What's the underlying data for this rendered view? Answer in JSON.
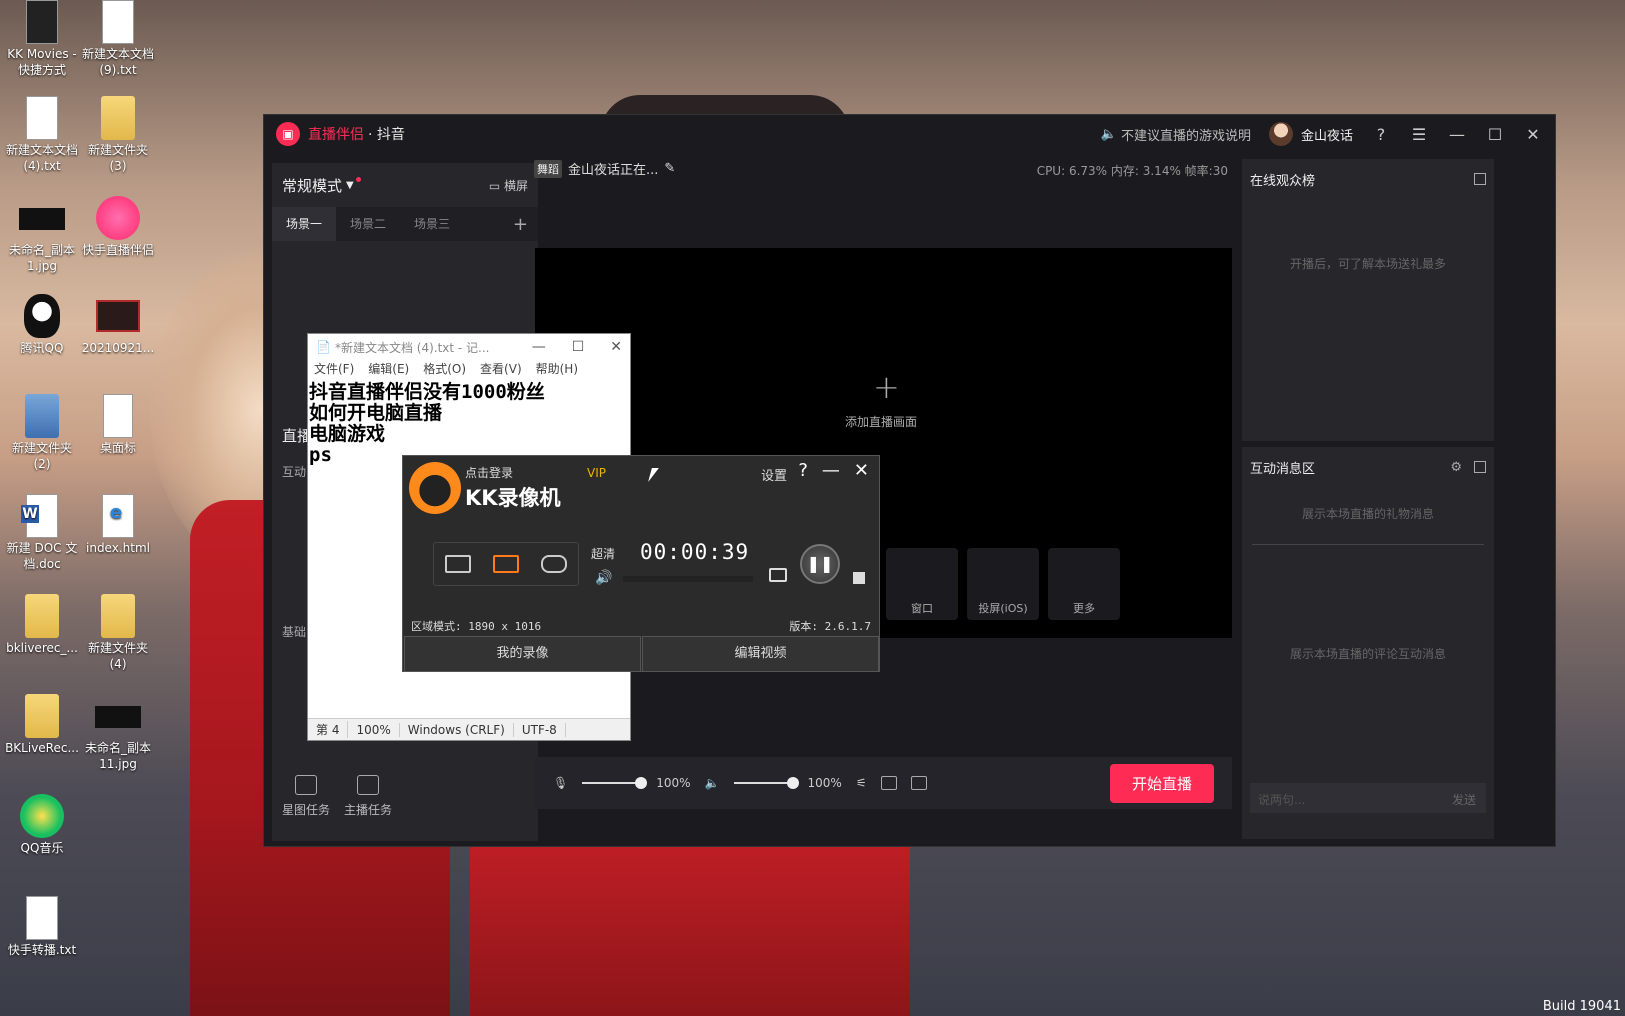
{
  "desktop": {
    "icons": [
      {
        "label": "KK Movies - 快捷方式",
        "type": "kk"
      },
      {
        "label": "新建文本文档 (9).txt",
        "type": "file"
      },
      {
        "label": "新建文本文档 (4).txt",
        "type": "file"
      },
      {
        "label": "新建文件夹 (3)",
        "type": "folder"
      },
      {
        "label": "未命名_副本 1.jpg",
        "type": "photo"
      },
      {
        "label": "快手直播伴侣",
        "type": "kuai"
      },
      {
        "label": "腾讯QQ",
        "type": "qq"
      },
      {
        "label": "20210921...",
        "type": "video"
      },
      {
        "label": "新建文件夹 (2)",
        "type": "winrar"
      },
      {
        "label": "桌面标",
        "type": "pdf"
      },
      {
        "label": "新建 DOC 文档.doc",
        "type": "doc"
      },
      {
        "label": "index.html",
        "type": "html"
      },
      {
        "label": "bkliverec_...",
        "type": "folder"
      },
      {
        "label": "新建文件夹 (4)",
        "type": "folder"
      },
      {
        "label": "BKLiveRec...",
        "type": "folder"
      },
      {
        "label": "未命名_副本 11.jpg",
        "type": "photo"
      },
      {
        "label": "QQ音乐",
        "type": "qqmusic"
      },
      {
        "label": "快手转播.txt",
        "type": "file"
      }
    ],
    "build_text": "Build 19041"
  },
  "app": {
    "title_brand": "直播伴侣",
    "title_platform": "· 抖音",
    "notice": "不建议直播的游戏说明",
    "username": "金山夜话",
    "help_icon": "?",
    "menu_icon": "☰",
    "minimize": "—",
    "maximize": "☐",
    "close": "✕",
    "accent": "#fe2c55",
    "left": {
      "mode": "常规模式",
      "landscape": "横屏",
      "scenes": [
        "场景一",
        "场景二",
        "场景三"
      ],
      "live_label": "直播",
      "interact_label": "互动",
      "basic_label": "基础",
      "tasks": [
        "星图任务",
        "主播任务"
      ]
    },
    "center": {
      "category_tag": "舞蹈",
      "live_title": "金山夜话正在...",
      "stats": "CPU: 6.73%   内存: 3.14%   帧率:30",
      "add_scene": "添加直播画面",
      "sources": [
        "窗口",
        "投屏(iOS)",
        "更多"
      ],
      "mic_volume": "100%",
      "speaker_volume": "100%",
      "start_button": "开始直播"
    },
    "right": {
      "audience_title": "在线观众榜",
      "audience_empty": "开播后，可了解本场送礼最多",
      "interact_title": "互动消息区",
      "gift_empty": "展示本场直播的礼物消息",
      "comment_empty": "展示本场直播的评论互动消息",
      "chat_placeholder": "说两句...",
      "send": "发送"
    }
  },
  "notepad": {
    "title": "*新建文本文档 (4).txt - 记...",
    "menu": [
      "文件(F)",
      "编辑(E)",
      "格式(O)",
      "查看(V)",
      "帮助(H)"
    ],
    "lines": [
      "抖音直播伴侣没有1000粉丝",
      "如何开电脑直播",
      "电脑游戏",
      "ps"
    ],
    "status": [
      "第 4",
      "100%",
      "Windows (CRLF)",
      "UTF-8"
    ]
  },
  "kk": {
    "login": "点击登录",
    "vip": "VIP",
    "name": "KK录像机",
    "settings": "设置",
    "help": "?",
    "minimize": "—",
    "close": "✕",
    "quality": "超清",
    "time": "00:00:39",
    "region": "区域模式: 1890 x 1016",
    "version": "版本: 2.6.1.7",
    "my_recordings": "我的录像",
    "edit_video": "编辑视频"
  }
}
